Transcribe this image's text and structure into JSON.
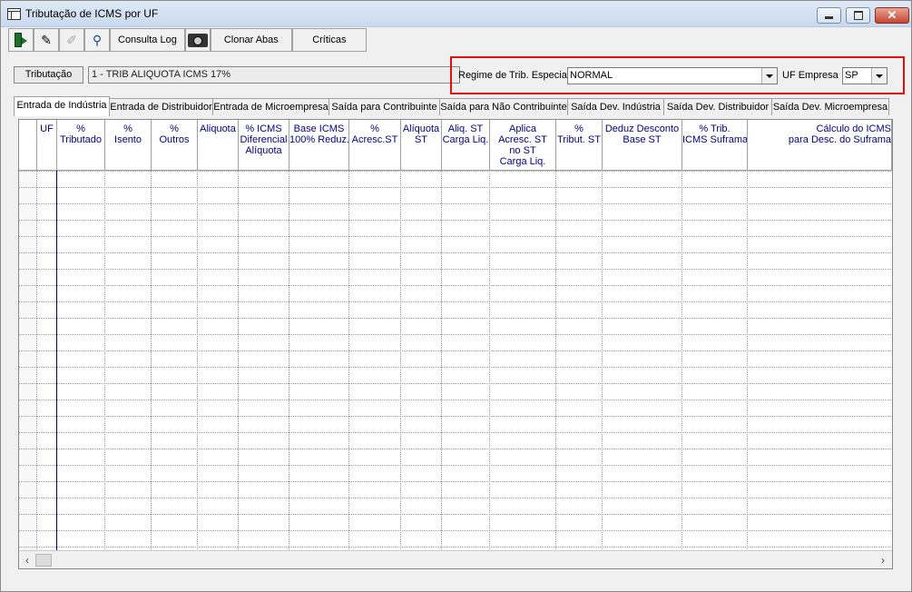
{
  "window": {
    "title": "Tributação de ICMS por UF"
  },
  "toolbar": {
    "icons": [
      "exit-icon",
      "eraser-icon",
      "pin-icon",
      "binoculars-icon"
    ],
    "consulta_log": "Consulta Log",
    "camera_icon": "camera-icon",
    "clonar_abas": "Clonar Abas",
    "criticas": "Críticas"
  },
  "tributacao": {
    "button": "Tributação",
    "value": "1  -  TRIB ALIQUOTA ICMS 17%"
  },
  "regime": {
    "label": "Regime de Trib. Especial",
    "value": "NORMAL"
  },
  "uf_empresa": {
    "label": "UF Empresa",
    "value": "SP"
  },
  "tabs": [
    "Entrada de Indústria",
    "Entrada de Distribuidor",
    "Entrada de Microempresa",
    "Saída para Contribuinte",
    "Saída para Não Contribuinte",
    "Saída Dev. Indústria",
    "Saída Dev. Distribuidor",
    "Saída Dev. Microempresa"
  ],
  "grid": {
    "headers": [
      "",
      "UF",
      "%\nTributado",
      "%\nIsento",
      "%\nOutros",
      "Aliquota",
      "% ICMS\nDiferencial\nAlíquota",
      "Base ICMS\n100% Reduz.",
      "%\nAcresc.ST",
      "Alíquota\nST",
      "Aliq. ST\nCarga Liq.",
      "Aplica\nAcresc. ST\nno ST\nCarga Liq.",
      "%\nTribut. ST",
      "Deduz Desconto\nBase ST",
      "% Trib.\nICMS Suframa",
      "Cálculo do ICMS\npara Desc. do Suframa"
    ],
    "row_count": 23
  },
  "colors": {
    "highlight_border": "#e01010",
    "header_text": "#00008b",
    "uf_separator": "#00008b"
  }
}
